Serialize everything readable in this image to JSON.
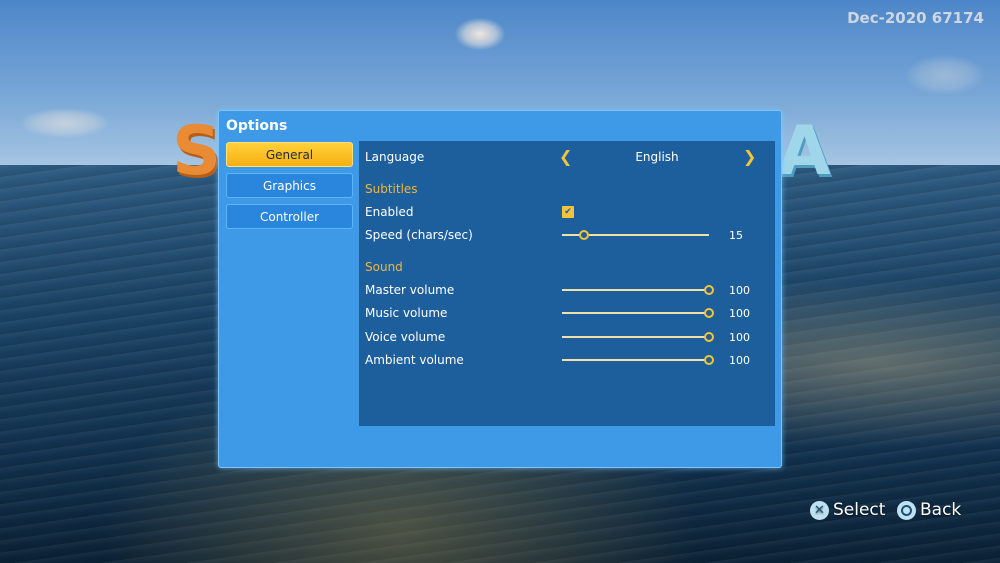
{
  "build_tag": "Dec-2020 67174",
  "window": {
    "title": "Options"
  },
  "tabs": [
    {
      "label": "General",
      "active": true
    },
    {
      "label": "Graphics",
      "active": false
    },
    {
      "label": "Controller",
      "active": false
    }
  ],
  "general": {
    "language": {
      "label": "Language",
      "value": "English",
      "prev_icon": "chevron-left-icon",
      "next_icon": "chevron-right-icon"
    },
    "subtitles": {
      "section": "Subtitles",
      "enabled": {
        "label": "Enabled",
        "checked": true
      },
      "speed": {
        "label": "Speed (chars/sec)",
        "value": "15",
        "fraction": 0.1
      }
    },
    "sound": {
      "section": "Sound",
      "master": {
        "label": "Master volume",
        "value": "100",
        "fraction": 1.0
      },
      "music": {
        "label": "Music volume",
        "value": "100",
        "fraction": 1.0
      },
      "voice": {
        "label": "Voice volume",
        "value": "100",
        "fraction": 1.0
      },
      "ambient": {
        "label": "Ambient volume",
        "value": "100",
        "fraction": 1.0
      }
    }
  },
  "prompts": {
    "select": {
      "label": "Select",
      "icon": "cross-button-icon"
    },
    "back": {
      "label": "Back",
      "icon": "circle-button-icon"
    }
  },
  "colors": {
    "accent": "#f3c43a",
    "window": "#3e9ae6",
    "panel": "#1d5f9d",
    "section_text": "#f2b53a"
  }
}
